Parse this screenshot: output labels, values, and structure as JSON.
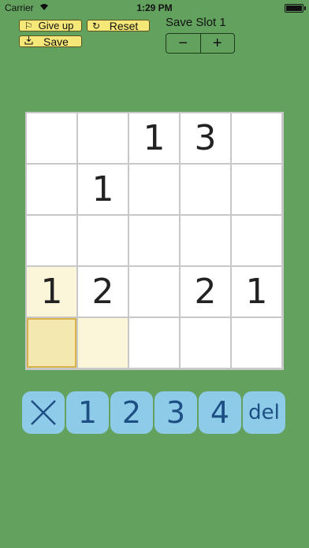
{
  "status_bar": {
    "carrier": "Carrier",
    "time": "1:29 PM"
  },
  "toolbar": {
    "give_up_label": "Give up",
    "reset_label": "Reset",
    "save_label": "Save"
  },
  "save_slot": {
    "title": "Save Slot 1",
    "minus": "−",
    "plus": "+"
  },
  "board": {
    "rows": [
      [
        "",
        "",
        "1",
        "3",
        ""
      ],
      [
        "",
        "1",
        "",
        "",
        ""
      ],
      [
        "",
        "",
        "",
        "",
        ""
      ],
      [
        "1",
        "2",
        "",
        "2",
        "1"
      ],
      [
        "",
        "",
        "",
        "",
        ""
      ]
    ],
    "highlighted_cells": [
      [
        3,
        0
      ],
      [
        4,
        1
      ]
    ],
    "selected_cell": [
      4,
      0
    ]
  },
  "keypad": {
    "clear_icon": "x-icon",
    "keys": [
      "1",
      "2",
      "3",
      "4"
    ],
    "delete_label": "del"
  },
  "colors": {
    "background": "#63a25e",
    "button_yellow": "#f6e878",
    "key_blue": "#8dcbe8",
    "key_text": "#1d4f84"
  }
}
